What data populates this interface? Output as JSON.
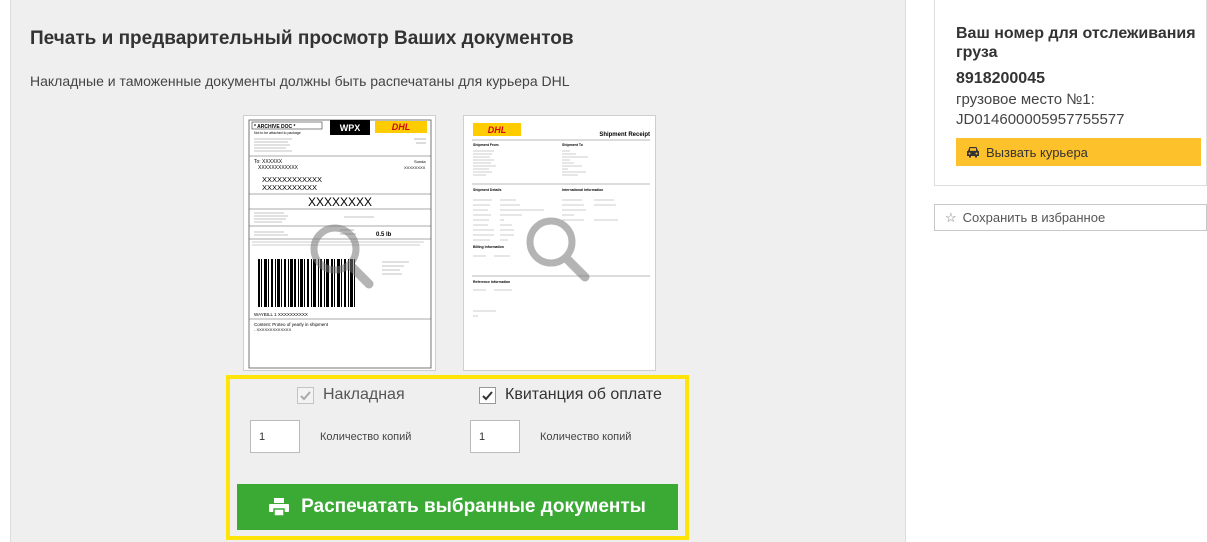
{
  "main": {
    "title": "Печать и предварительный просмотр Ваших документов",
    "subtitle": "Накладные и таможенные документы должны быть распечатаны для курьера DHL"
  },
  "documents": [
    {
      "label": "Накладная",
      "checked": true,
      "disabled": true,
      "copies_value": "1",
      "copies_label": "Количество копий",
      "preview": {
        "archive_doc": "* ARCHIVE DOC *",
        "not_attached": "Not to be attached to package",
        "product_code": "WPX",
        "logo": "DHL",
        "to_line": "To: XXXXXX",
        "name_line_1": "XXXXXXXXXXXX",
        "name_line_2": "XXXXXXXXXXX",
        "big_code": "XXXXXXXX",
        "weight": "0.5 lb",
        "waybill": "WAYBILL 1  XXXXXXXXXX",
        "contents": "Content: Proteo of yearly in shipment",
        "contents_sub": "- XXXXXXXXXXXXX"
      }
    },
    {
      "label": "Квитанция об оплате",
      "checked": true,
      "disabled": false,
      "copies_value": "1",
      "copies_label": "Количество копий",
      "preview": {
        "logo": "DHL",
        "title": "Shipment Receipt",
        "shipment_from": "Shipment From",
        "shipment_to": "Shipment To",
        "shipment_details": "Shipment Details",
        "international_info": "International Information",
        "billing_info": "Billing Information",
        "reference_info": "Reference Information"
      }
    }
  ],
  "print_button": {
    "label": "Распечатать выбранные документы",
    "icon": "printer-icon"
  },
  "tracking": {
    "title": "Ваш номер для отслеживания груза",
    "number": "8918200045",
    "piece_label": "грузовое место №1:",
    "piece_id": "JD014600005957755577",
    "courier_button": "Вызвать курьера",
    "courier_icon": "car-icon"
  },
  "favorites": {
    "label": "Сохранить в избранное",
    "icon": "star-icon"
  },
  "colors": {
    "highlight_border": "#ffe40a",
    "print_button": "#3aaa35",
    "courier_button": "#fcc12b",
    "panel_bg": "#efefef",
    "dhl_yellow": "#ffcc00",
    "dhl_red": "#d40511"
  }
}
